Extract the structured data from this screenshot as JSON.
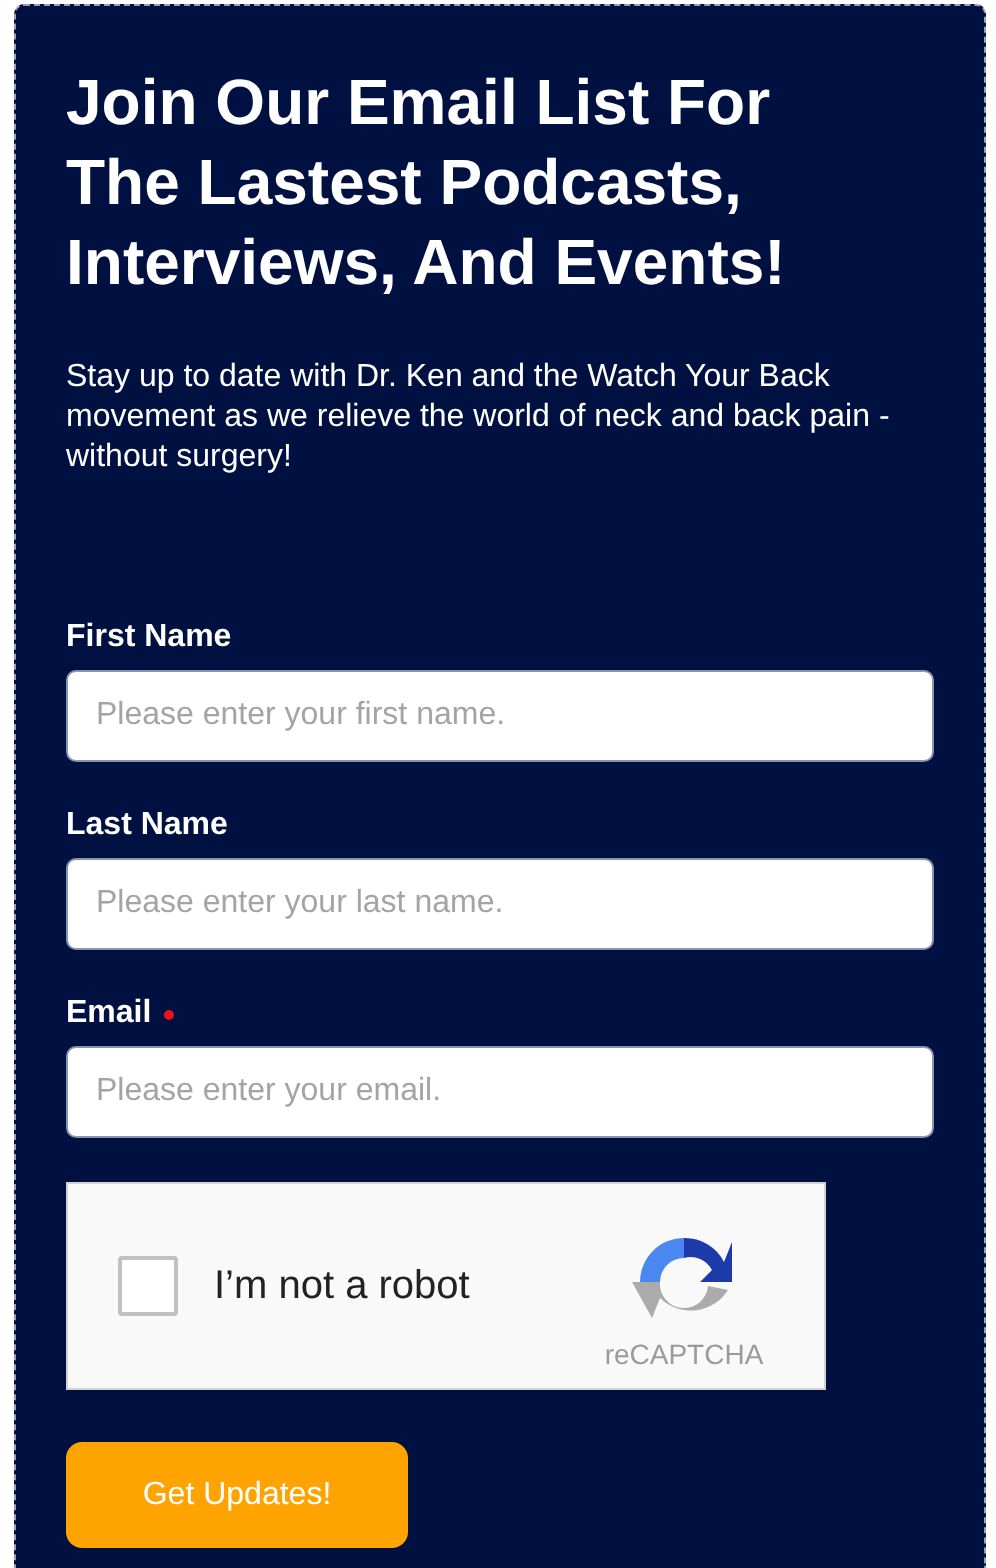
{
  "heading": "Join Our Email List For The Lastest Podcasts, Interviews, And Events!",
  "description": "Stay up to date with Dr. Ken and the Watch Your Back movement as we relieve the world of neck and back pain - without surgery!",
  "fields": [
    {
      "label": "First Name",
      "placeholder": "Please enter your first name.",
      "required": false
    },
    {
      "label": "Last Name",
      "placeholder": "Please enter your last name.",
      "required": false
    },
    {
      "label": "Email",
      "placeholder": "Please enter your email.",
      "required": true
    }
  ],
  "captcha": {
    "label": "I’m not a robot",
    "checked": false,
    "brand": "reCAPTCHA"
  },
  "submit_button": "Get Updates!"
}
